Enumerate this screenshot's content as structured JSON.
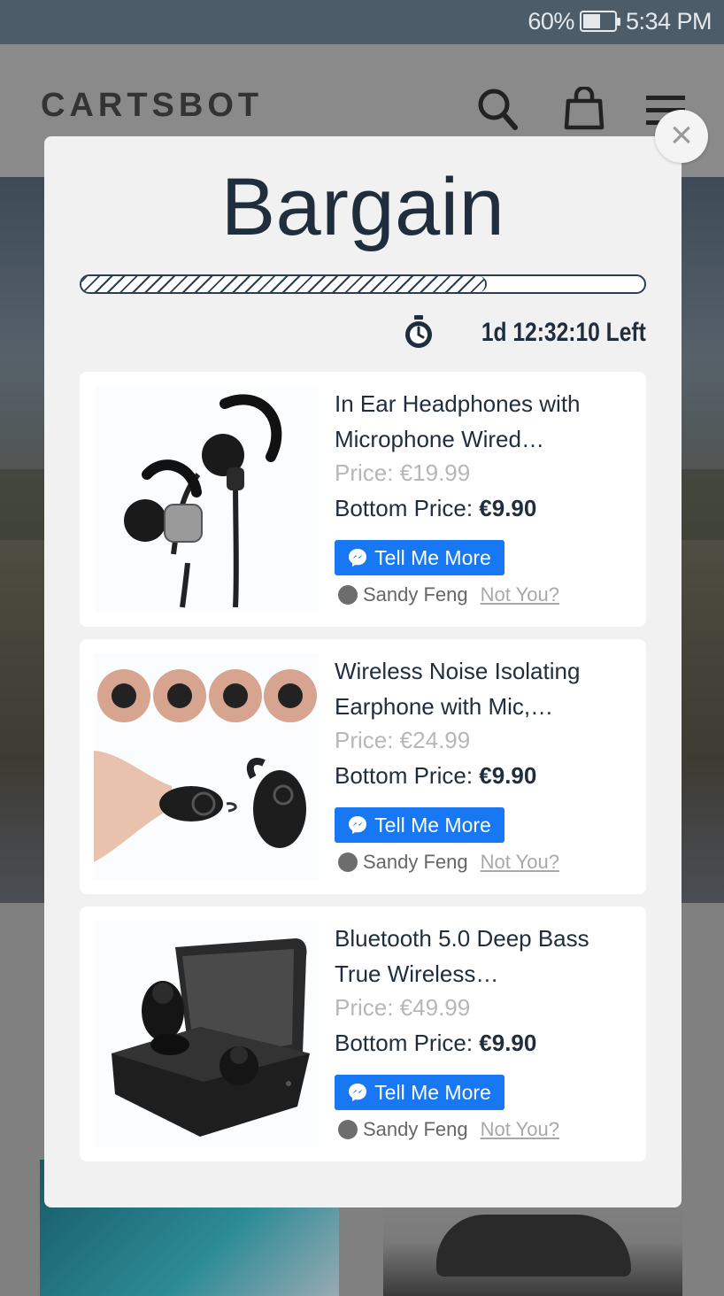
{
  "status_bar": {
    "battery": "60%",
    "battery_level": 0.6,
    "time": "5:34 PM"
  },
  "site": {
    "brand": "CARTSBOT",
    "icons": [
      "search-icon",
      "shopping-bag-icon",
      "menu-icon"
    ]
  },
  "modal": {
    "title": "Bargain",
    "progress": 0.72,
    "timer_icon": "stopwatch-icon",
    "timer": "1d 12:32:10 Left",
    "close_icon": "close-icon",
    "products": [
      {
        "title": "In Ear Headphones with Microphone Wired…",
        "price": "Price: €19.99",
        "bottom_price_label": "Bottom Price: ",
        "bottom_price": "€9.90",
        "button": "Tell Me More",
        "user": "Sandy Feng",
        "not_you": "Not You?"
      },
      {
        "title": "Wireless Noise Isolating Earphone with Mic,…",
        "price": "Price: €24.99",
        "bottom_price_label": "Bottom Price: ",
        "bottom_price": "€9.90",
        "button": "Tell Me More",
        "user": "Sandy Feng",
        "not_you": "Not You?"
      },
      {
        "title": "Bluetooth 5.0 Deep Bass True Wireless…",
        "price": "Price: €49.99",
        "bottom_price_label": "Bottom Price: ",
        "bottom_price": "€9.90",
        "button": "Tell Me More",
        "user": "Sandy Feng",
        "not_you": "Not You?"
      }
    ]
  }
}
